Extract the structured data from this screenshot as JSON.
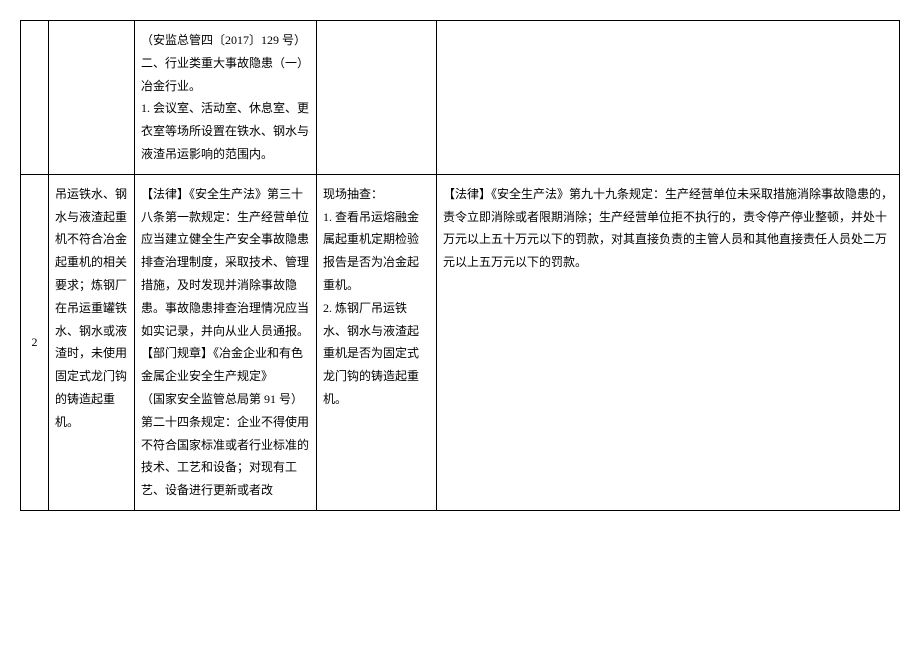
{
  "table": {
    "rows": [
      {
        "num": "",
        "title": "",
        "basis": "（安监总管四〔2017〕129 号）\n二、行业类重大事故隐患（一）冶金行业。\n1. 会议室、活动室、休息室、更衣室等场所设置在铁水、钢水与液渣吊运影响的范围内。",
        "check": "",
        "law": ""
      },
      {
        "num": "2",
        "title": "吊运铁水、钢水与液渣起重机不符合冶金起重机的相关要求；炼钢厂在吊运重罐铁水、钢水或液渣时，未使用固定式龙门钩的铸造起重机。",
        "basis": "【法律】《安全生产法》第三十八条第一款规定：生产经营单位应当建立健全生产安全事故隐患排查治理制度，采取技术、管理措施，及时发现并消除事故隐患。事故隐患排查治理情况应当如实记录，并向从业人员通报。\n【部门规章】《冶金企业和有色金属企业安全生产规定》\n（国家安全监管总局第 91 号）第二十四条规定：企业不得使用不符合国家标准或者行业标准的技术、工艺和设备；对现有工艺、设备进行更新或者改",
        "check": "现场抽查：\n1. 查看吊运熔融金属起重机定期检验报告是否为冶金起重机。\n2. 炼钢厂吊运铁水、钢水与液渣起重机是否为固定式龙门钩的铸造起重机。",
        "law": "【法律】《安全生产法》第九十九条规定：生产经营单位未采取措施消除事故隐患的，责令立即消除或者限期消除；生产经营单位拒不执行的，责令停产停业整顿，并处十万元以上五十万元以下的罚款，对其直接负责的主管人员和其他直接责任人员处二万元以上五万元以下的罚款。"
      }
    ]
  }
}
